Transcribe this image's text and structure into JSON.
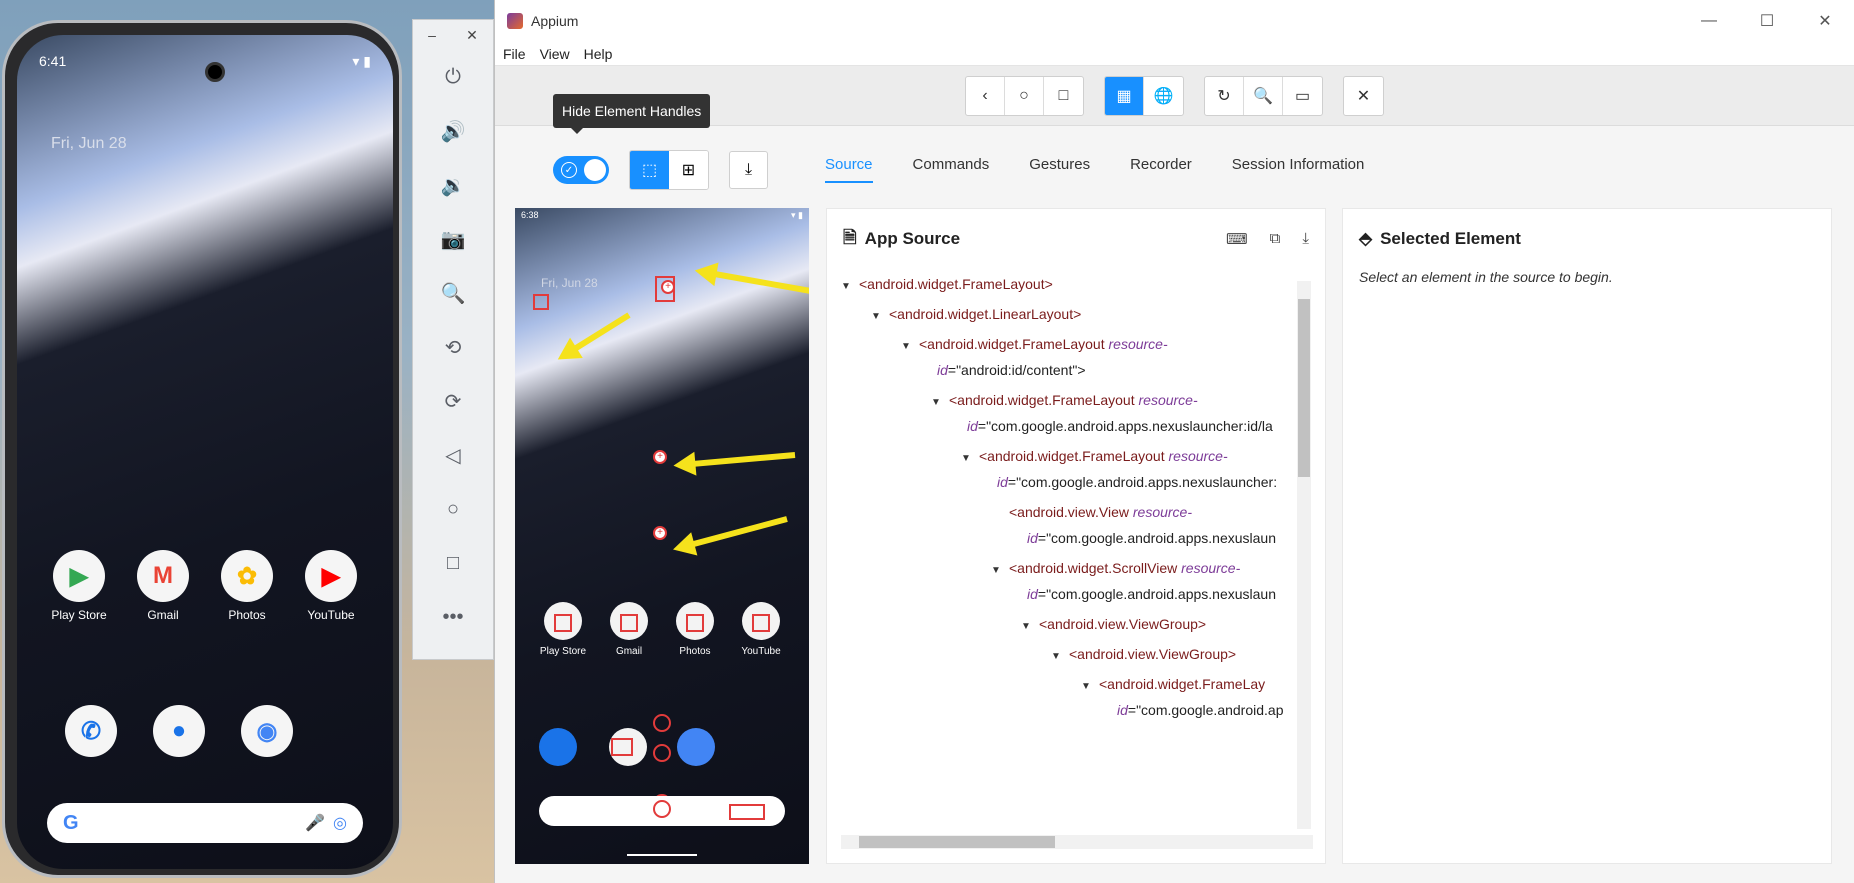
{
  "phone": {
    "time": "6:41",
    "date": "Fri, Jun 28",
    "apps_row1": [
      {
        "label": "Play Store",
        "glyph": "▶",
        "color": "#34a853"
      },
      {
        "label": "Gmail",
        "glyph": "M",
        "color": "#ea4335"
      },
      {
        "label": "Photos",
        "glyph": "✿",
        "color": "#fbbc05"
      },
      {
        "label": "YouTube",
        "glyph": "▶",
        "color": "#ff0000"
      }
    ],
    "dock": [
      {
        "name": "phone-app-icon",
        "glyph": "✆",
        "color": "#1a73e8"
      },
      {
        "name": "messages-app-icon",
        "glyph": "●",
        "color": "#1a73e8"
      },
      {
        "name": "chrome-app-icon",
        "glyph": "◉",
        "color": "#4285f4"
      }
    ],
    "search_glyph": "G"
  },
  "emulator": {
    "minimize": "–",
    "close": "✕",
    "buttons": [
      {
        "name": "power-icon",
        "glyph": "⏻"
      },
      {
        "name": "volume-up-icon",
        "glyph": "🔊"
      },
      {
        "name": "volume-down-icon",
        "glyph": "🔉"
      },
      {
        "name": "camera-icon",
        "glyph": "📷"
      },
      {
        "name": "zoom-icon",
        "glyph": "🔍"
      },
      {
        "name": "rotate-left-icon",
        "glyph": "⟲"
      },
      {
        "name": "rotate-right-icon",
        "glyph": "⟳"
      },
      {
        "name": "back-icon",
        "glyph": "◁"
      },
      {
        "name": "home-icon",
        "glyph": "○"
      },
      {
        "name": "overview-icon",
        "glyph": "□"
      },
      {
        "name": "more-icon",
        "glyph": "•••"
      }
    ]
  },
  "window": {
    "title": "Appium",
    "menu": [
      "File",
      "View",
      "Help"
    ],
    "controls": {
      "minimize": "—",
      "maximize": "☐",
      "close": "✕"
    }
  },
  "toolbar": {
    "nav": [
      "‹",
      "○",
      "□"
    ],
    "view": [
      "▦",
      "🌐"
    ],
    "actions": [
      "↻",
      "🔍",
      "▭"
    ],
    "quit": "✕"
  },
  "tooltip": "Hide Element Handles",
  "tabs": [
    "Source",
    "Commands",
    "Gestures",
    "Recorder",
    "Session Information"
  ],
  "screenshot": {
    "time": "6:38",
    "date": "Fri, Jun 28",
    "apps": [
      "Play Store",
      "Gmail",
      "Photos",
      "YouTube"
    ]
  },
  "app_source": {
    "title": "App Source",
    "nodes": [
      {
        "indent": 0,
        "arrow": "▼",
        "tag": "<android.widget.FrameLayout>",
        "attr": "",
        "val": ""
      },
      {
        "indent": 1,
        "arrow": "▼",
        "tag": "<android.widget.LinearLayout>",
        "attr": "",
        "val": ""
      },
      {
        "indent": 2,
        "arrow": "▼",
        "tag": "<android.widget.FrameLayout ",
        "attr": "resource-",
        "val": ""
      },
      {
        "indent": 2,
        "arrow": "",
        "tag": "",
        "attr": "id",
        "val": "=\"android:id/content\">"
      },
      {
        "indent": 3,
        "arrow": "▼",
        "tag": "<android.widget.FrameLayout ",
        "attr": "resource-",
        "val": ""
      },
      {
        "indent": 3,
        "arrow": "",
        "tag": "",
        "attr": "id",
        "val": "=\"com.google.android.apps.nexuslauncher:id/la"
      },
      {
        "indent": 4,
        "arrow": "▼",
        "tag": "<android.widget.FrameLayout ",
        "attr": "resource-",
        "val": ""
      },
      {
        "indent": 4,
        "arrow": "",
        "tag": "",
        "attr": "id",
        "val": "=\"com.google.android.apps.nexuslauncher:"
      },
      {
        "indent": 5,
        "arrow": "",
        "tag": "<android.view.View ",
        "attr": "resource-",
        "val": ""
      },
      {
        "indent": 5,
        "arrow": "",
        "tag": "",
        "attr": "id",
        "val": "=\"com.google.android.apps.nexuslaun"
      },
      {
        "indent": 5,
        "arrow": "▼",
        "tag": "<android.widget.ScrollView ",
        "attr": "resource-",
        "val": ""
      },
      {
        "indent": 5,
        "arrow": "",
        "tag": "",
        "attr": "id",
        "val": "=\"com.google.android.apps.nexuslaun"
      },
      {
        "indent": 6,
        "arrow": "▼",
        "tag": "<android.view.ViewGroup>",
        "attr": "",
        "val": ""
      },
      {
        "indent": 7,
        "arrow": "▼",
        "tag": "<android.view.ViewGroup>",
        "attr": "",
        "val": ""
      },
      {
        "indent": 8,
        "arrow": "▼",
        "tag": "<android.widget.FrameLay",
        "attr": "",
        "val": ""
      },
      {
        "indent": 8,
        "arrow": "",
        "tag": "",
        "attr": "id",
        "val": "=\"com.google.android.ap"
      }
    ]
  },
  "selected_element": {
    "title": "Selected Element",
    "message": "Select an element in the source to begin."
  }
}
